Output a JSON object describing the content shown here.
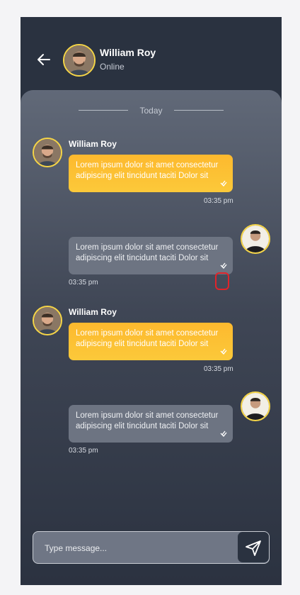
{
  "header": {
    "name": "William Roy",
    "status": "Online"
  },
  "chat": {
    "date_label": "Today",
    "messages": [
      {
        "sender": "William Roy",
        "text": "Lorem ipsum dolor sit amet consectetur adipiscing elit tincidunt taciti Dolor sit",
        "time": "03:35 pm",
        "direction": "incoming"
      },
      {
        "sender": "",
        "text": "Lorem ipsum dolor sit amet consectetur adipiscing elit tincidunt taciti Dolor sit",
        "time": "03:35 pm",
        "direction": "outgoing"
      },
      {
        "sender": "William Roy",
        "text": "Lorem ipsum dolor sit amet consectetur adipiscing elit tincidunt taciti Dolor sit",
        "time": "03:35 pm",
        "direction": "incoming"
      },
      {
        "sender": "",
        "text": "Lorem ipsum dolor sit amet consectetur adipiscing elit tincidunt taciti Dolor sit",
        "time": "03:35 pm",
        "direction": "outgoing"
      }
    ]
  },
  "composer": {
    "placeholder": "Type message..."
  },
  "colors": {
    "accent": "#fdb92e",
    "avatar_ring": "#f5d547",
    "background": "#2a3240",
    "outgoing_bubble": "#6d7482",
    "highlight": "#e0242a"
  },
  "icons": {
    "back": "arrow-left-icon",
    "send": "send-icon",
    "read": "double-check-icon"
  }
}
